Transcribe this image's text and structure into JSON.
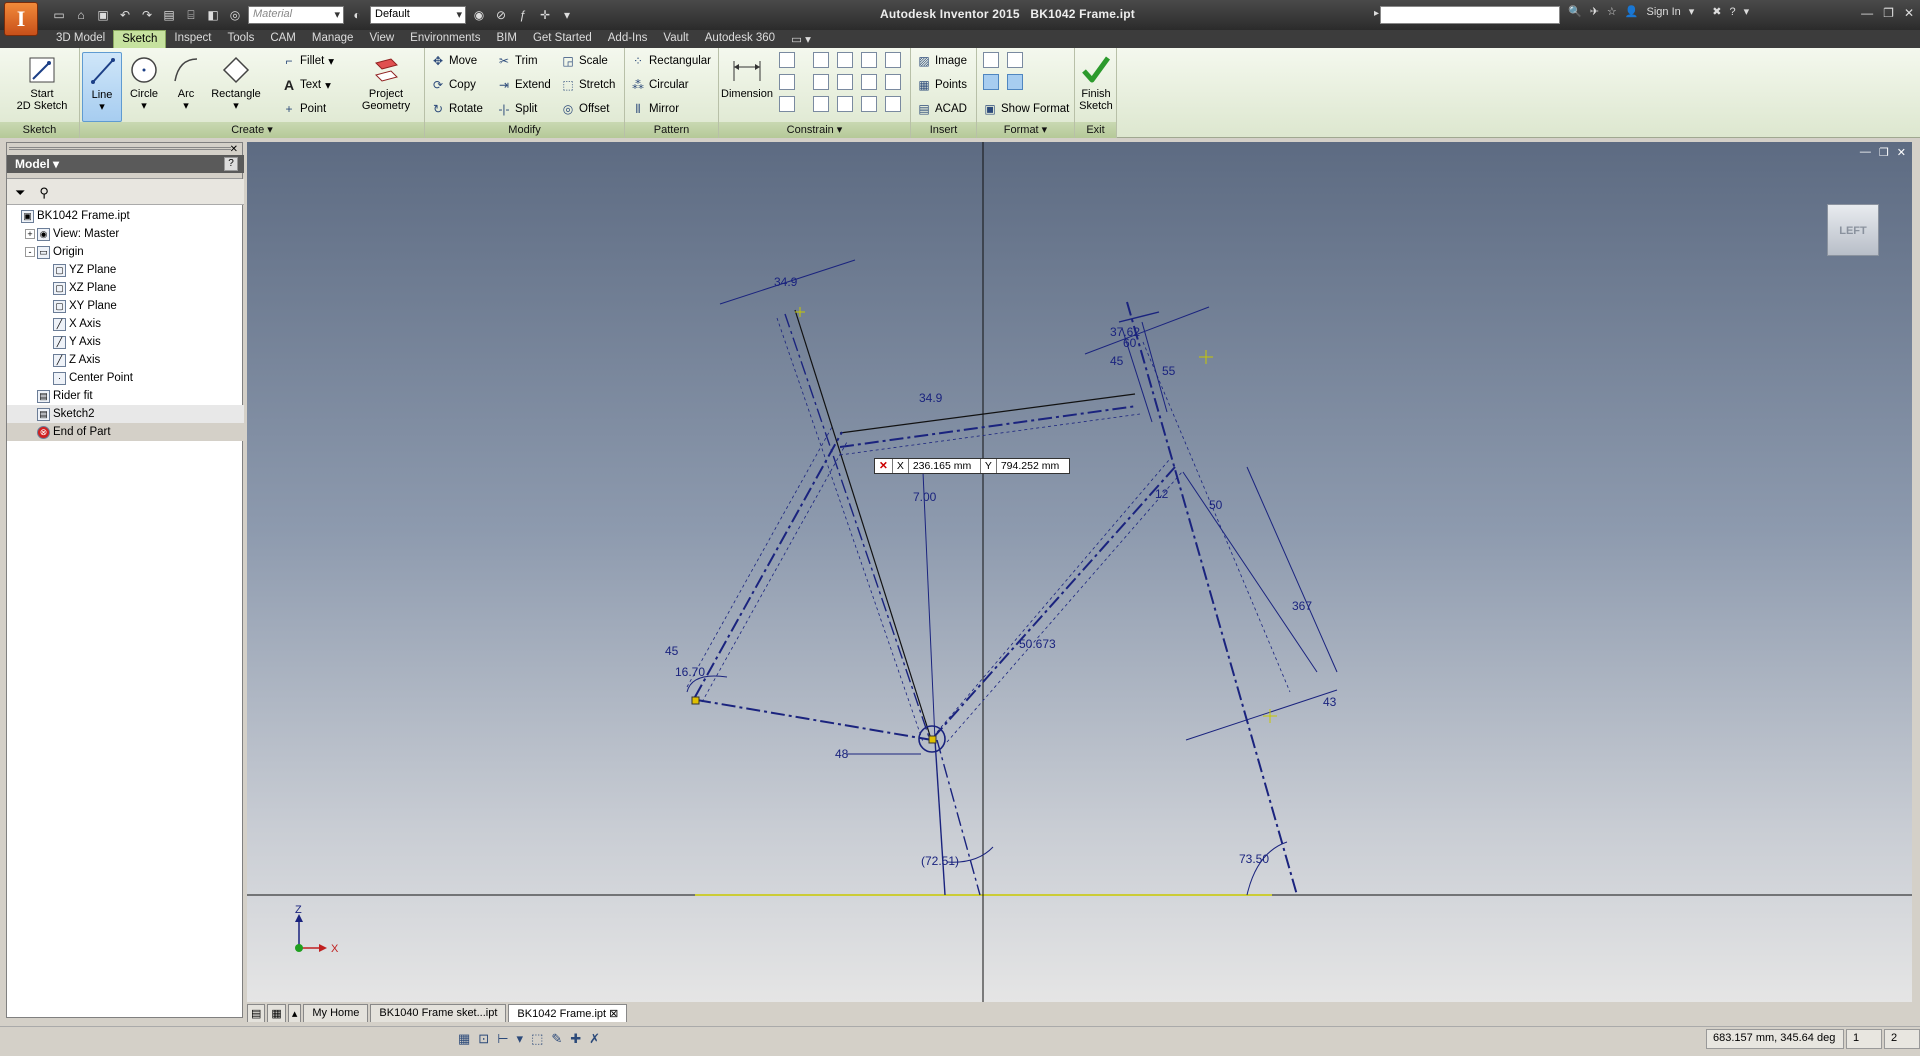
{
  "title": {
    "app": "Autodesk Inventor 2015",
    "file": "BK1042 Frame.ipt",
    "material_placeholder": "Material",
    "appearance": "Default",
    "sign_in": "Sign In"
  },
  "ribbon_tabs": [
    "3D Model",
    "Sketch",
    "Inspect",
    "Tools",
    "CAM",
    "Manage",
    "View",
    "Environments",
    "BIM",
    "Get Started",
    "Add-Ins",
    "Vault",
    "Autodesk 360"
  ],
  "active_tab": "Sketch",
  "panels": {
    "sketch": {
      "label": "Sketch",
      "start": "Start\n2D Sketch"
    },
    "create": {
      "label": "Create",
      "line": "Line",
      "circle": "Circle",
      "arc": "Arc",
      "rectangle": "Rectangle",
      "fillet": "Fillet",
      "text": "Text",
      "point": "Point",
      "project": "Project\nGeometry"
    },
    "modify": {
      "label": "Modify",
      "move": "Move",
      "trim": "Trim",
      "scale": "Scale",
      "copy": "Copy",
      "extend": "Extend",
      "stretch": "Stretch",
      "rotate": "Rotate",
      "split": "Split",
      "offset": "Offset"
    },
    "pattern": {
      "label": "Pattern",
      "rectangular": "Rectangular",
      "circular": "Circular",
      "mirror": "Mirror"
    },
    "constrain": {
      "label": "Constrain",
      "dimension": "Dimension"
    },
    "insert": {
      "label": "Insert",
      "image": "Image",
      "points": "Points",
      "acad": "ACAD"
    },
    "format": {
      "label": "Format",
      "show_format": "Show Format"
    },
    "exit": {
      "label": "Exit",
      "finish": "Finish\nSketch"
    }
  },
  "browser": {
    "title": "Model",
    "help": "?",
    "tree": [
      {
        "label": "BK1042 Frame.ipt",
        "level": 0,
        "toggle": ""
      },
      {
        "label": "View: Master",
        "level": 1,
        "toggle": "+"
      },
      {
        "label": "Origin",
        "level": 1,
        "toggle": "-"
      },
      {
        "label": "YZ Plane",
        "level": 2,
        "toggle": ""
      },
      {
        "label": "XZ Plane",
        "level": 2,
        "toggle": ""
      },
      {
        "label": "XY Plane",
        "level": 2,
        "toggle": ""
      },
      {
        "label": "X Axis",
        "level": 2,
        "toggle": ""
      },
      {
        "label": "Y Axis",
        "level": 2,
        "toggle": ""
      },
      {
        "label": "Z Axis",
        "level": 2,
        "toggle": ""
      },
      {
        "label": "Center Point",
        "level": 2,
        "toggle": ""
      },
      {
        "label": "Rider fit",
        "level": 1,
        "toggle": ""
      },
      {
        "label": "Sketch2",
        "level": 1,
        "toggle": ""
      },
      {
        "label": "End of Part",
        "level": 1,
        "toggle": ""
      }
    ]
  },
  "viewcube": "LEFT",
  "coord_input": {
    "x_label": "X",
    "x_value": "236.165 mm",
    "y_label": "Y",
    "y_value": "794.252 mm"
  },
  "dimensions": {
    "d1": "34.9",
    "d2": "34.9",
    "d3": "7.00",
    "d4": "37.62",
    "d5": "45",
    "d6": "60",
    "d7": "55",
    "d8": "12",
    "d9": "50",
    "d10": "367",
    "d11": "50.673",
    "d12": "45",
    "d13": "16.70",
    "d14": "48",
    "d15": "43",
    "d16": "(72.51)",
    "d17": "73.50"
  },
  "axes": {
    "z": "Z",
    "x": "X"
  },
  "doc_tabs": [
    "My Home",
    "BK1040 Frame sket...ipt",
    "BK1042 Frame.ipt"
  ],
  "active_doc": "BK1042 Frame.ipt",
  "status": {
    "coords": "683.157 mm, 345.64 deg",
    "a": "1",
    "b": "2"
  }
}
